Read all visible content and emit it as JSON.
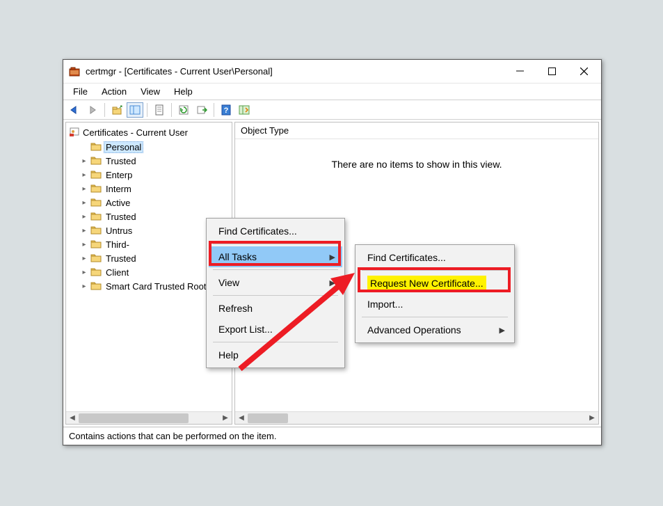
{
  "title": "certmgr - [Certificates - Current User\\Personal]",
  "menubar": {
    "file": "File",
    "action": "Action",
    "view": "View",
    "help": "Help"
  },
  "tree": {
    "root": "Certificates - Current User",
    "items": [
      "Personal",
      "Trusted",
      "Enterp",
      "Interm",
      "Active",
      "Trusted",
      "Untrus",
      "Third-",
      "Trusted",
      "Client",
      "Smart Card Trusted Roots"
    ]
  },
  "right": {
    "header": "Object Type",
    "empty": "There are no items to show in this view."
  },
  "status": "Contains actions that can be performed on the item.",
  "ctx1": {
    "find": "Find Certificates...",
    "alltasks": "All Tasks",
    "view": "View",
    "refresh": "Refresh",
    "export": "Export List...",
    "help": "Help"
  },
  "ctx2": {
    "find": "Find Certificates...",
    "request": "Request New Certificate...",
    "import": "Import...",
    "advanced": "Advanced Operations"
  }
}
